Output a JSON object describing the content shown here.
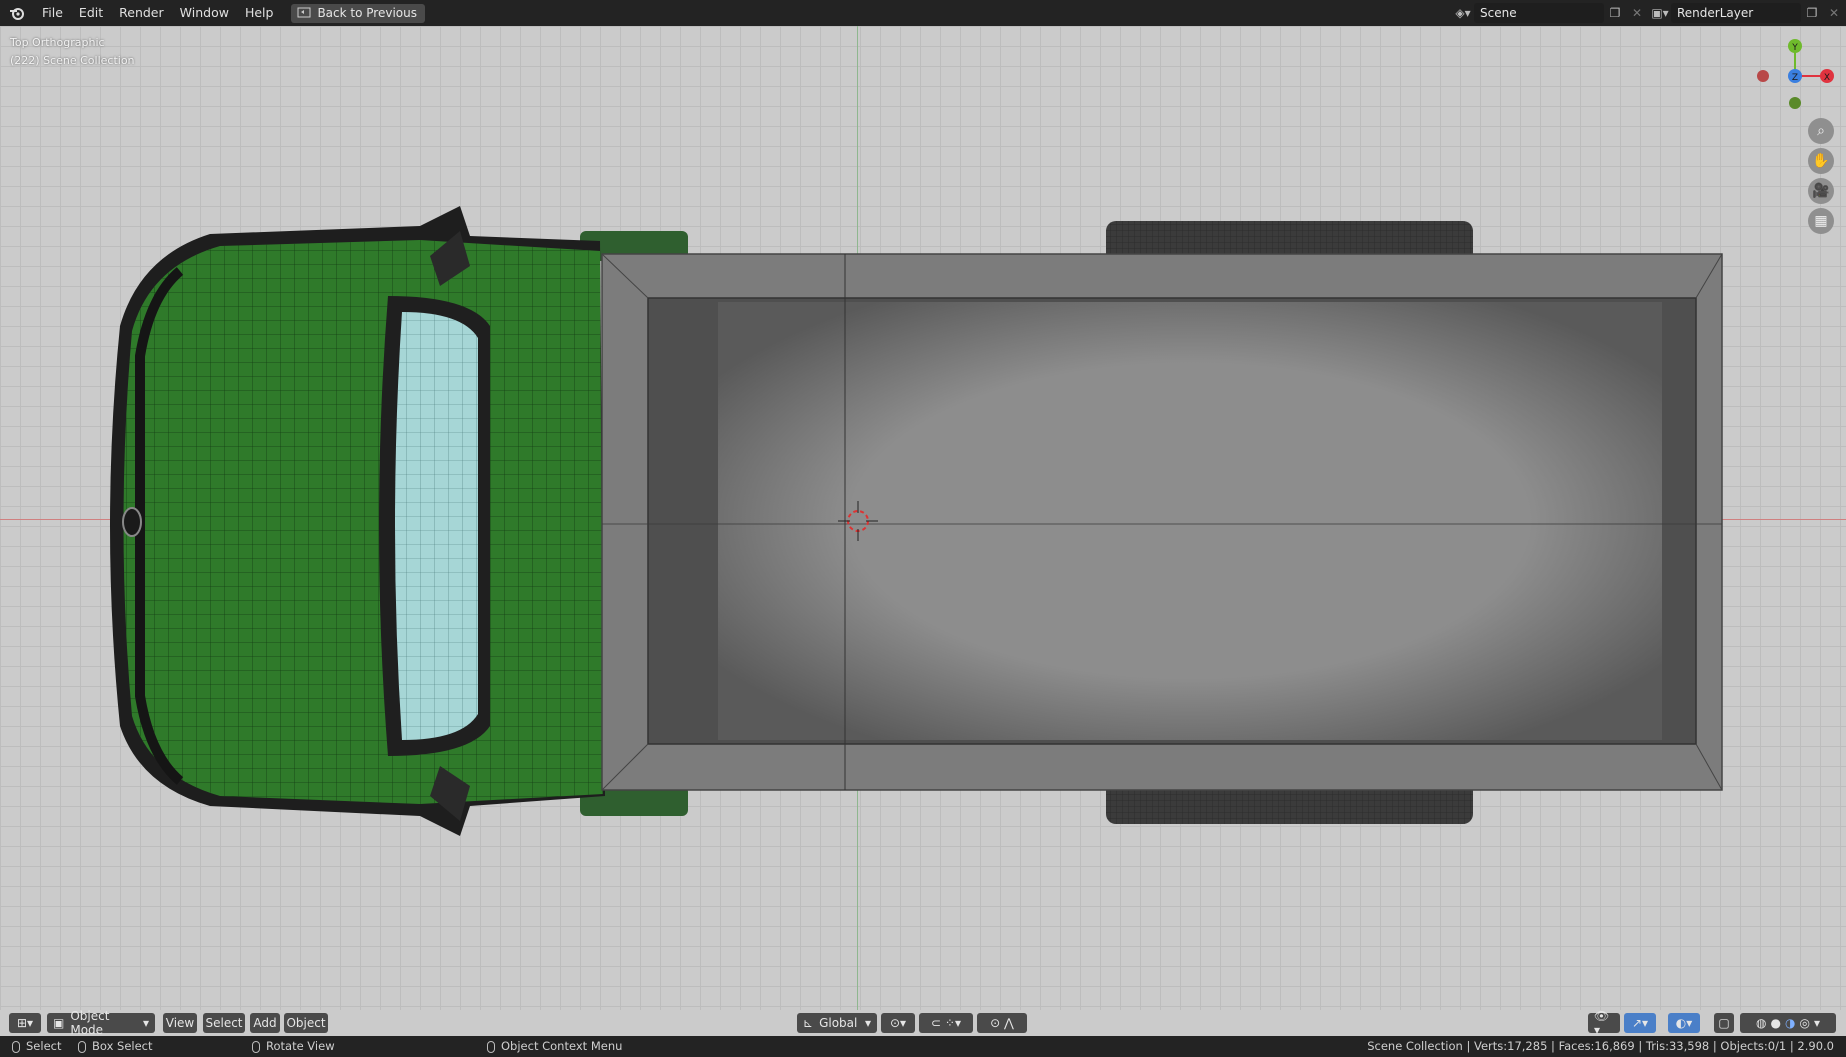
{
  "menu": {
    "items": [
      "File",
      "Edit",
      "Render",
      "Window",
      "Help"
    ],
    "back_label": "Back to Previous"
  },
  "scene": {
    "name": "Scene"
  },
  "render_layer": {
    "name": "RenderLayer"
  },
  "viewport": {
    "view_name": "Top Orthographic",
    "collection": "(222) Scene Collection"
  },
  "gizmo": {
    "y": "Y",
    "z": "Z",
    "x": "X"
  },
  "header": {
    "mode": "Object Mode",
    "view": "View",
    "select": "Select",
    "add": "Add",
    "object": "Object",
    "orientation": "Global"
  },
  "status": {
    "select": "Select",
    "box_select": "Box Select",
    "rotate_view": "Rotate View",
    "context_menu": "Object Context Menu",
    "stats": "Scene Collection | Verts:17,285 | Faces:16,869 | Tris:33,598 | Objects:0/1 | 2.90.0"
  },
  "colors": {
    "cab_green": "#2f7a2a",
    "window": "#a6d6d6",
    "bed": "#8a8a8a",
    "accent": "#4a90e2"
  }
}
